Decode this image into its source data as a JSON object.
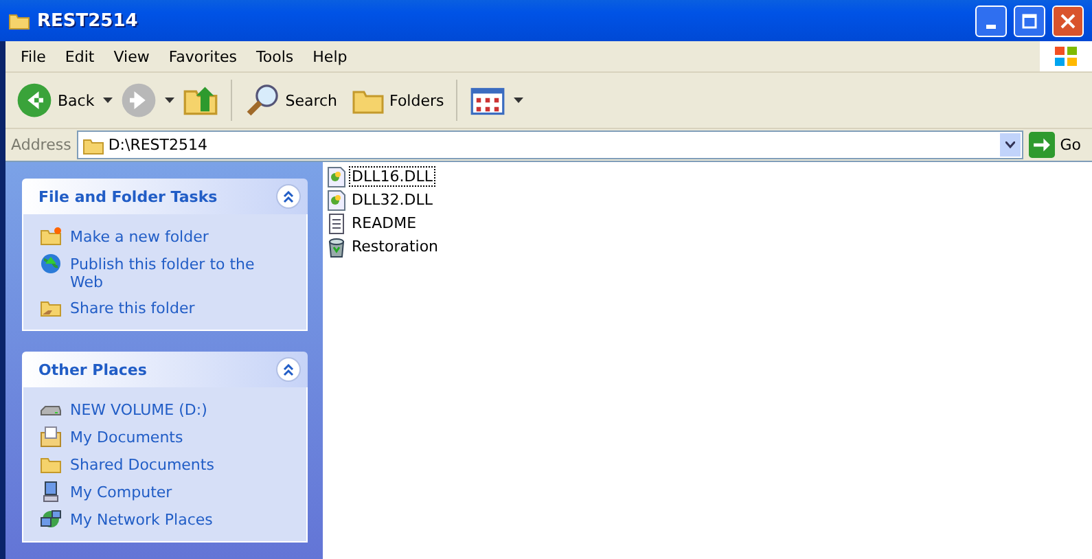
{
  "window": {
    "title": "REST2514"
  },
  "menu": [
    "File",
    "Edit",
    "View",
    "Favorites",
    "Tools",
    "Help"
  ],
  "toolbar": [
    {
      "kind": "back",
      "label": "Back"
    },
    {
      "kind": "forward"
    },
    {
      "kind": "up"
    },
    {
      "kind": "search",
      "label": "Search"
    },
    {
      "kind": "folders",
      "label": "Folders"
    },
    {
      "kind": "views"
    }
  ],
  "address": {
    "label": "Address",
    "value": "D:\\REST2514",
    "go": "Go"
  },
  "panels": [
    {
      "title": "File and Folder Tasks",
      "expanded": true,
      "items": [
        {
          "kind": "new-folder",
          "label": "Make a new folder"
        },
        {
          "kind": "publish",
          "label": "Publish this folder to the Web"
        },
        {
          "kind": "share",
          "label": "Share this folder"
        }
      ]
    },
    {
      "title": "Other Places",
      "expanded": true,
      "items": [
        {
          "kind": "drive",
          "label": "NEW VOLUME (D:)"
        },
        {
          "kind": "documents",
          "label": "My Documents"
        },
        {
          "kind": "folder",
          "label": "Shared Documents"
        },
        {
          "kind": "computer",
          "label": "My Computer"
        },
        {
          "kind": "network",
          "label": "My Network Places"
        }
      ]
    }
  ],
  "files": [
    {
      "kind": "dll",
      "name": "DLL16.DLL",
      "focused": true
    },
    {
      "kind": "dll",
      "name": "DLL32.DLL",
      "focused": false
    },
    {
      "kind": "text",
      "name": "README",
      "focused": false
    },
    {
      "kind": "app",
      "name": "Restoration",
      "focused": false
    }
  ]
}
